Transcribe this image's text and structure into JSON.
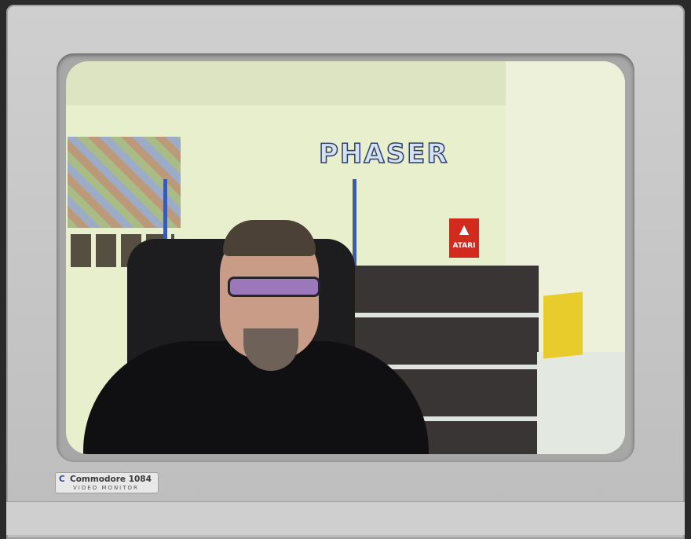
{
  "monitor": {
    "brand_icon": "commodore-logo-icon",
    "model_label": "Commodore 1084",
    "subtitle": "VIDEO MONITOR"
  },
  "screen": {
    "wall_sign_text": "PHASER",
    "atari_sign_text": "ATARI",
    "atari_icon": "atari-fuji-icon"
  },
  "colors": {
    "bezel": "#c8c8c8",
    "screen_wall": "#e8efcd",
    "phaser_text": "#d6e1f2",
    "atari_red": "#d32a1e"
  }
}
